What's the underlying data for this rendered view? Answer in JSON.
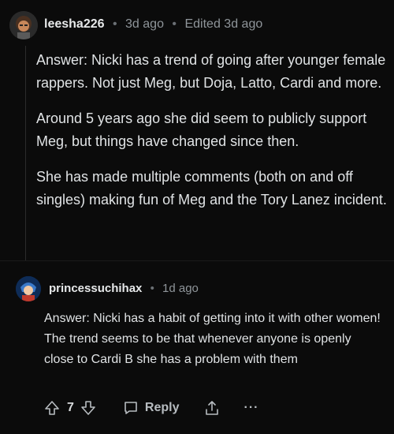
{
  "comments": [
    {
      "username": "leesha226",
      "time": "3d ago",
      "edited": "Edited 3d ago",
      "paragraphs": [
        "Answer: Nicki has a trend of going after younger female rappers. Not just Meg, but Doja, Latto, Cardi and more.",
        "Around 5 years ago she did seem to publicly support Meg, but things have changed since then.",
        "She has made multiple comments (both on and off singles) making fun of Meg and the Tory Lanez incident."
      ]
    },
    {
      "username": "princessuchihax",
      "time": "1d ago",
      "body": "Answer: Nicki has a habit of getting into it with other women! The trend seems to be that whenever anyone is openly close to Cardi B she has a problem with them",
      "votes": "7",
      "reply_label": "Reply",
      "more_label": "···"
    }
  ],
  "separator": "•",
  "icons": {
    "avatar1": "avatar-character-icon",
    "avatar2": "avatar-character-icon",
    "upvote": "arrow-up-icon",
    "downvote": "arrow-down-icon",
    "reply": "speech-bubble-icon",
    "share": "share-upload-icon",
    "more": "ellipsis-icon"
  }
}
